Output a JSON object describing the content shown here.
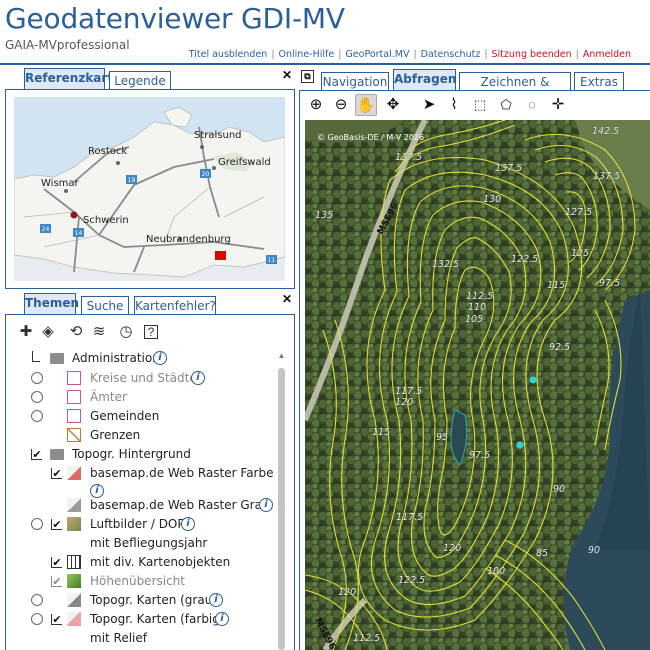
{
  "header": {
    "title": "Geodatenviewer GDI-MV",
    "subtitle": "GAIA-MVprofessional",
    "links": [
      {
        "label": "Titel ausblenden",
        "color": "blue"
      },
      {
        "label": "Online-Hilfe",
        "color": "blue"
      },
      {
        "label": "GeoPortal.MV",
        "color": "blue"
      },
      {
        "label": "Datenschutz",
        "color": "blue"
      },
      {
        "label": "Sitzung beenden",
        "color": "red"
      },
      {
        "label": "Anmelden",
        "color": "red"
      }
    ]
  },
  "left_top": {
    "tabs": [
      "Referenzkarte",
      "Legende"
    ],
    "active_tab": "Referenzkarte",
    "overview_places": [
      "Stralsund",
      "Rostock",
      "Greifswald",
      "Wismar",
      "Schwerin",
      "Neubrandenburg"
    ],
    "road_shields": [
      "19",
      "20",
      "24",
      "14",
      "11"
    ]
  },
  "left_bottom": {
    "tabs": [
      "Themen",
      "Suche",
      "Kartenfehler?"
    ],
    "active_tab": "Themen",
    "toolbar_icons": [
      "add-layer-icon",
      "layers-icon",
      "refresh-icon",
      "layers-stack-icon",
      "history-clock-icon",
      "help-icon"
    ],
    "tree": [
      {
        "label": "Administration",
        "type": "folder",
        "info": true
      },
      {
        "label": "Kreise und Städte",
        "type": "layer",
        "grey": true,
        "info": true
      },
      {
        "label": "Ämter",
        "type": "layer",
        "grey": true,
        "info": false
      },
      {
        "label": "Gemeinden",
        "type": "layer",
        "grey": false,
        "info": false
      },
      {
        "label": "Grenzen",
        "type": "layer",
        "grey": false,
        "info": false
      },
      {
        "label": "Topogr. Hintergrund",
        "type": "folder",
        "info": false
      },
      {
        "label": "basemap.de Web Raster Farbe",
        "type": "layer",
        "checked": true
      },
      {
        "label": "basemap.de Web Raster Grau",
        "type": "layer",
        "info": true
      },
      {
        "label": "Luftbilder / DOP",
        "type": "layer",
        "checked": true,
        "info": true
      },
      {
        "label": "mit Befliegungsjahr",
        "type": "sublayer"
      },
      {
        "label": "mit div. Kartenobjekten",
        "type": "sublayer",
        "checked": true
      },
      {
        "label": "Höhenübersicht",
        "type": "layer",
        "grey": true,
        "checked": true
      },
      {
        "label": "Topogr. Karten (grau)",
        "type": "layer",
        "info": true
      },
      {
        "label": "Topogr. Karten (farbig)",
        "type": "layer",
        "checked": true,
        "info": true
      },
      {
        "label": "mit Relief",
        "type": "sublayer"
      }
    ]
  },
  "map_panel": {
    "tabs": [
      "Navigation",
      "Abfragen",
      "Zeichnen & Messen",
      "Extras"
    ],
    "active_tab": "Abfragen",
    "tools": [
      "zoom-in-icon",
      "zoom-out-icon",
      "pan-hand-icon",
      "recenter-icon",
      "info-pointer-icon",
      "info-line-icon",
      "info-rect-icon",
      "info-polygon-icon",
      "info-circle-icon",
      "info-point-icon"
    ],
    "copyright": "© GeoBasis-DE / M-V 2026",
    "road_labels": [
      "MSE96",
      "MSE96"
    ],
    "contour_labels": [
      "142.5",
      "137.5",
      "137.5",
      "137.5",
      "135",
      "130",
      "127.5",
      "125",
      "122.5",
      "132.5",
      "115",
      "112.5",
      "110",
      "105",
      "97.5",
      "92.5",
      "117.5",
      "120",
      "115",
      "95",
      "97.5",
      "90",
      "117.5",
      "120",
      "85",
      "90",
      "100",
      "122.5",
      "120",
      "112.5"
    ]
  },
  "colors": {
    "brand_blue": "#2a5f99",
    "link_red": "#c8102e",
    "contour": "#e8e436",
    "marker": "#2fd3e0"
  }
}
